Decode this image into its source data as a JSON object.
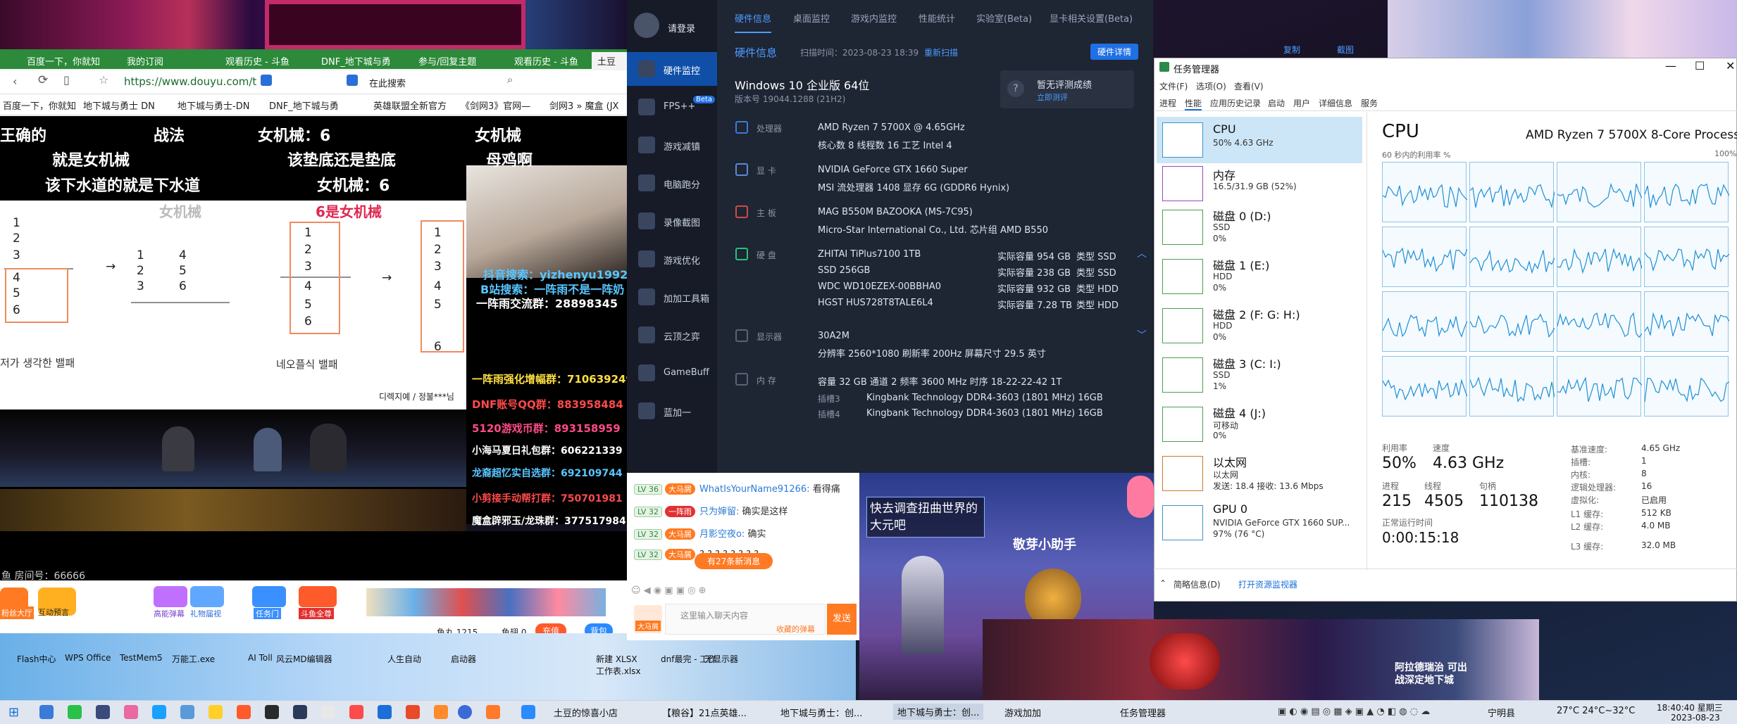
{
  "browser": {
    "tabs": [
      "百度一下，你就知",
      "我的订阅",
      "观看历史 - 斗鱼",
      "DNF_地下城与勇",
      "参与/回复主题",
      "观看历史 - 斗鱼",
      "土豆"
    ],
    "url": "https://www.douyu.com/t",
    "search_label": "在此搜索",
    "bookmarks": [
      "百度一下，你就知",
      "地下城与勇士 DN",
      "地下城与勇士-DN",
      "DNF_地下城与勇",
      "英雄联盟全新官方",
      "《剑网3》官网—",
      "剑网3 » 魔盒 (JX"
    ]
  },
  "stream": {
    "header_lines": [
      "王确的",
      "战法",
      "女机械：6",
      "女机械",
      "就是女机械",
      "该垫底还是垫底",
      "母鸡啊",
      "该下水道的就是下水道",
      "女机械：6"
    ],
    "slide_title": "女机械",
    "slide_red": "6是女机械",
    "slide_caption_left": "저가 생각한 밸패",
    "slide_caption_mid": "네오플식 밸패",
    "slide_credit": "디렉지예 / 정불***님",
    "panel_lines": [
      {
        "text": "抖音搜索：yizhenyu1992",
        "color": "#58c6ff"
      },
      {
        "text": "B站搜索：一阵雨不是一阵奶",
        "color": "#58c6ff"
      },
      {
        "text": "一阵雨交流群：28898345",
        "color": "#ffffff"
      },
      {
        "text": "一阵雨强化增幅群：710639249",
        "color": "#ffe040"
      },
      {
        "text": "DNF账号QQ群：883958484",
        "color": "#ff4a4a"
      },
      {
        "text": "5120游戏币群：893158959",
        "color": "#ff4a8a"
      },
      {
        "text": "小海马夏日礼包群：606221339",
        "color": "#ffffff"
      },
      {
        "text": "龙裔超忆实自选群：692109744",
        "color": "#58c6ff"
      },
      {
        "text": "小剪接手动帮打群：750701981",
        "color": "#ff4a4a"
      },
      {
        "text": "魔盒辟邪玉/龙珠群：377517984",
        "color": "#ffffff"
      }
    ],
    "room_number": "鱼 房间号：66666",
    "dock_items": [
      "粉丝大厅",
      "互动预言",
      "高能弹幕",
      "礼物届视",
      "任务门",
      "斗鱼全尊"
    ],
    "fish_pill": "鱼丸 1215",
    "fish_bar": "鱼翅 0",
    "recharge": "充值",
    "backpack": "背包"
  },
  "desktop_icons": [
    "Flash中心",
    "WPS Office",
    "TestMem5",
    "万能工.exe",
    "AI Toll",
    "风云MD编辑器",
    "人生自动",
    "启动器",
    "新建 XLSX 工作表.xlsx",
    "dnf最完 - 工作",
    "无显示器"
  ],
  "hw": {
    "login": "请登录",
    "sidebar": [
      "硬件监控",
      "FPS++",
      "游戏减镇",
      "电脑跑分",
      "录像截图",
      "游戏优化",
      "加加工具箱",
      "云顶之弈",
      "GameBuff",
      "蓝加一"
    ],
    "beta": "Beta",
    "tabs": [
      "硬件信息",
      "桌面监控",
      "游戏内监控",
      "性能统计",
      "实验室(Beta)",
      "显卡相关设置(Beta)"
    ],
    "section_title": "硬件信息",
    "scan_time": "扫描时间：2023-08-23 18:39",
    "rescan": "重新扫描",
    "detail_btn": "硬件详情",
    "copy": "复制",
    "screenshot": "截图",
    "os": "Windows 10 企业版 64位",
    "version": "版本号 19044.1288 (21H2)",
    "eval_title": "暂无评测成绩",
    "eval_link": "立即测评",
    "cpu_label": "处理器",
    "cpu_name": "AMD Ryzen 7 5700X @ 4.65GHz",
    "cpu_detail": "核心数  8    线程数  16    工艺  Intel 4",
    "gpu_label": "显 卡",
    "gpu_name": "NVIDIA GeForce GTX 1660 Super",
    "gpu_detail": "MSI    流处理器  1408    显存  6G (GDDR6 Hynix)",
    "mb_label": "主 板",
    "mb_name": "MAG B550M BAZOOKA (MS-7C95)",
    "mb_detail": "Micro-Star International Co., Ltd.    芯片组  AMD B550",
    "disk_label": "硬 盘",
    "disks": [
      {
        "name": "ZHITAI TiPlus7100 1TB",
        "cap": "实际容量  954 GB",
        "type": "类型  SSD"
      },
      {
        "name": "SSD 256GB",
        "cap": "实际容量  238 GB",
        "type": "类型  SSD"
      },
      {
        "name": "WDC WD10EZEX-00BBHA0",
        "cap": "实际容量  932 GB",
        "type": "类型  HDD"
      },
      {
        "name": "HGST HUS728T8TALE6L4",
        "cap": "实际容量  7.28 TB",
        "type": "类型  HDD"
      }
    ],
    "monitor_label": "显示器",
    "monitor_name": "30A2M",
    "monitor_detail": "分辨率  2560*1080    刷新率  200Hz    屏幕尺寸  29.5 英寸",
    "mem_label": "内 存",
    "mem_detail": "容量  32 GB    通道  2    频率  3600 MHz    时序  18-22-22-42 1T",
    "slots": [
      {
        "slot": "插槽3",
        "name": "Kingbank Technology DDR4-3603 (1801 MHz) 16GB"
      },
      {
        "slot": "插槽4",
        "name": "Kingbank Technology DDR4-3603 (1801 MHz) 16GB"
      }
    ]
  },
  "chat": {
    "lines": [
      {
        "lv": "LV 36",
        "badge": "大马屑",
        "user": "WhatIsYourName91266:",
        "msg": "看得痛"
      },
      {
        "lv": "LV 32",
        "badge": "一阵雨",
        "user": "只为婶留:",
        "msg": "确实是这样"
      },
      {
        "lv": "LV 32",
        "badge": "大马屑",
        "user": "月影空夜o:",
        "msg": "确实"
      },
      {
        "lv": "LV 32",
        "badge": "大马屑",
        "user": "",
        "msg": "? ? ? ? ? ? ? ?"
      }
    ],
    "new_msgs": "有27条新消息",
    "input_placeholder": "这里输入聊天内容",
    "hint": "收藏的弹幕",
    "send": "发送",
    "user_badge": "大马屑"
  },
  "game": {
    "bubble1": "快去调查扭曲世界的大元吧",
    "helper": "敬芽小助手",
    "bubble2": "阿拉德瑞治 可出战深定地下城"
  },
  "tm": {
    "title": "任务管理器",
    "menus": [
      "文件(F)",
      "选项(O)",
      "查看(V)"
    ],
    "tabs": [
      "进程",
      "性能",
      "应用历史记录",
      "启动",
      "用户",
      "详细信息",
      "服务"
    ],
    "items": [
      {
        "name": "CPU",
        "sub1": "50% 4.63 GHz",
        "sub2": "",
        "sub3": ""
      },
      {
        "name": "内存",
        "sub1": "16.5/31.9 GB (52%)",
        "sub2": "",
        "sub3": ""
      },
      {
        "name": "磁盘 0 (D:)",
        "sub1": "SSD",
        "sub2": "0%",
        "sub3": ""
      },
      {
        "name": "磁盘 1 (E:)",
        "sub1": "HDD",
        "sub2": "0%",
        "sub3": ""
      },
      {
        "name": "磁盘 2 (F: G: H:)",
        "sub1": "HDD",
        "sub2": "0%",
        "sub3": ""
      },
      {
        "name": "磁盘 3 (C: I:)",
        "sub1": "SSD",
        "sub2": "1%",
        "sub3": ""
      },
      {
        "name": "磁盘 4 (J:)",
        "sub1": "可移动",
        "sub2": "0%",
        "sub3": ""
      },
      {
        "name": "以太网",
        "sub1": "以太网",
        "sub2": "发送: 18.4 接收: 13.6 Mbps",
        "sub3": ""
      },
      {
        "name": "GPU 0",
        "sub1": "NVIDIA GeForce GTX 1660 SUP...",
        "sub2": "97% (76 °C)",
        "sub3": ""
      }
    ],
    "cpu_title": "CPU",
    "cpu_model": "AMD Ryzen 7 5700X 8-Core Processor",
    "util_label": "60 秒内的利用率 %",
    "util_max": "100%",
    "stats": {
      "util_label": "利用率",
      "util": "50%",
      "speed_label": "速度",
      "speed": "4.63 GHz",
      "proc_label": "进程",
      "proc": "215",
      "thr_label": "线程",
      "thr": "4505",
      "handle_label": "句柄",
      "handle": "110138",
      "uptime_label": "正常运行时间",
      "uptime": "0:00:15:18"
    },
    "specs": [
      {
        "k": "基准速度:",
        "v": "4.65 GHz"
      },
      {
        "k": "插槽:",
        "v": "1"
      },
      {
        "k": "内核:",
        "v": "8"
      },
      {
        "k": "逻辑处理器:",
        "v": "16"
      },
      {
        "k": "虚拟化:",
        "v": "已启用"
      },
      {
        "k": "L1 缓存:",
        "v": "512 KB"
      },
      {
        "k": "L2 缓存:",
        "v": "4.0 MB"
      },
      {
        "k": "L3 缓存:",
        "v": "32.0 MB"
      }
    ],
    "brief": "简略信息(D)",
    "resmon": "打开资源监视器"
  },
  "taskbar": {
    "apps": [
      "土豆的惊喜小店",
      "【粮谷】21点英雄...",
      "地下城与勇士：创...",
      "地下城与勇士：创...",
      "游戏加加",
      "任务管理器"
    ],
    "weather_loc": "宁明县",
    "weather": "27°C  24°C~32°C",
    "time": "18:40:40 星期三",
    "date": "2023-08-23"
  }
}
